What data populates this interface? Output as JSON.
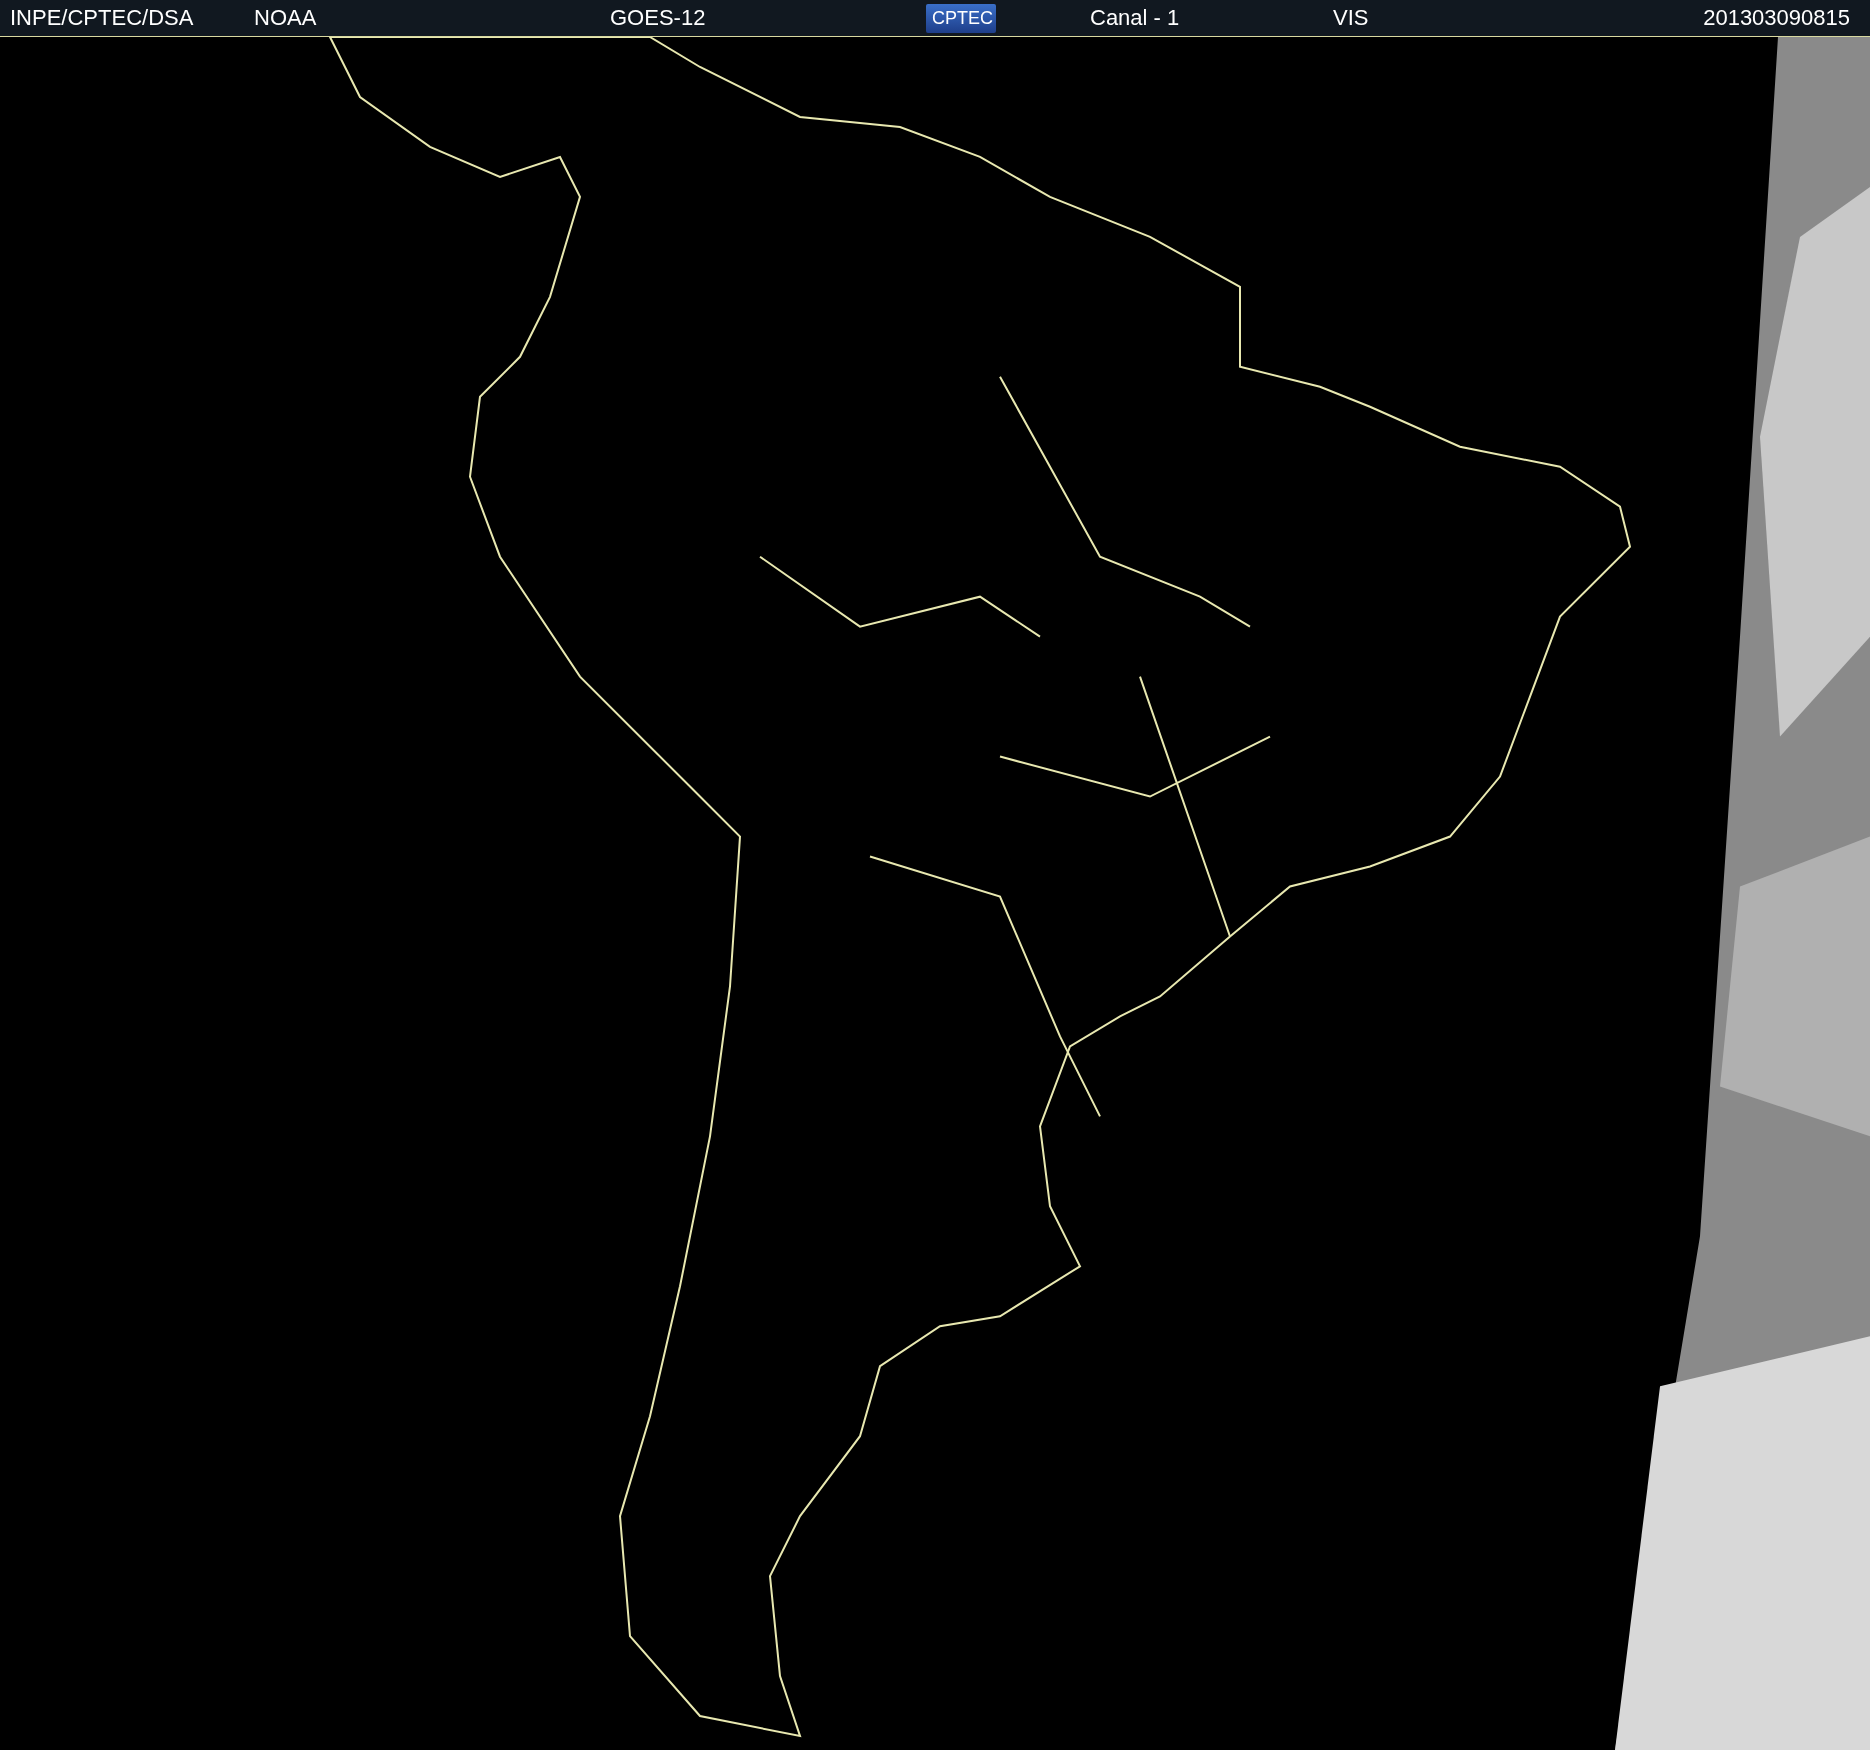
{
  "header": {
    "items": [
      {
        "kind": "text",
        "text": "INPE/CPTEC/DSA"
      },
      {
        "kind": "text",
        "text": "NOAA"
      },
      {
        "kind": "text",
        "text": "GOES-12"
      },
      {
        "kind": "logo",
        "text": "CPTEC"
      },
      {
        "kind": "text",
        "text": "Canal - 1"
      },
      {
        "kind": "text",
        "text": "VIS"
      },
      {
        "kind": "text",
        "text": "201303090815"
      }
    ]
  }
}
